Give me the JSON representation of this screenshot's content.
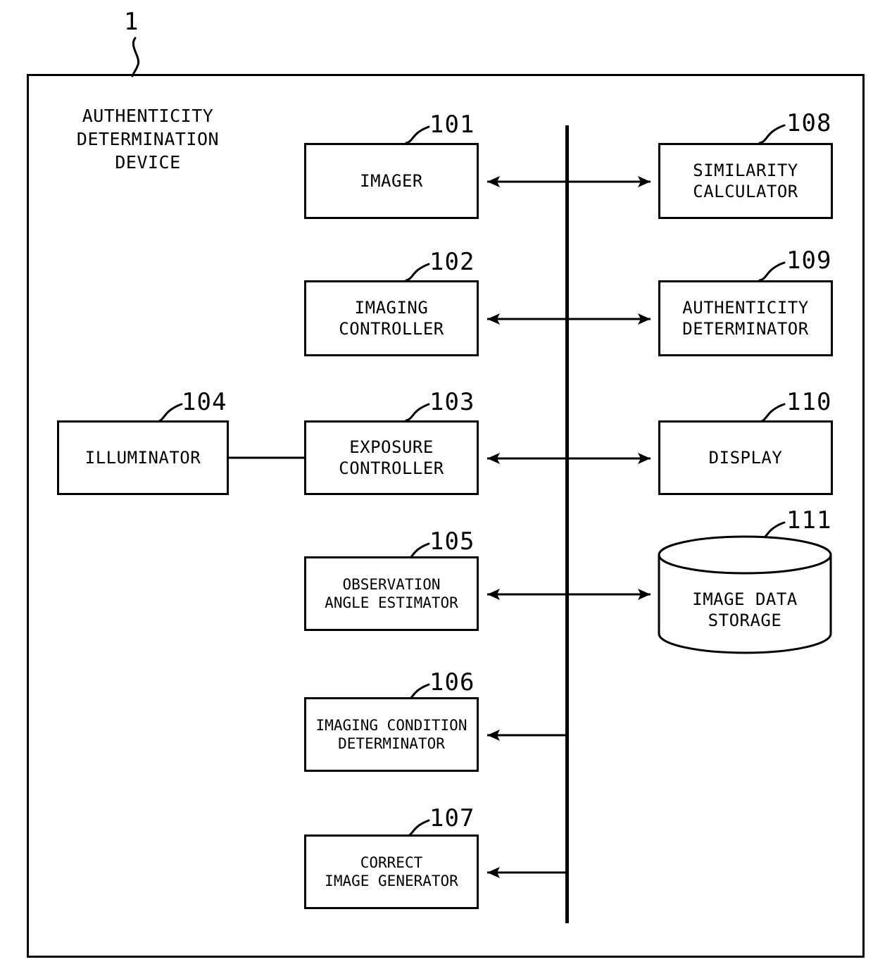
{
  "figure": {
    "reference_numeral": "1",
    "device_title": "AUTHENTICITY\nDETERMINATION\nDEVICE"
  },
  "blocks": [
    {
      "id": "imager",
      "ref": "101",
      "label": "IMAGER",
      "shape": "rect",
      "column": "center",
      "row": 1
    },
    {
      "id": "imaging-controller",
      "ref": "102",
      "label": "IMAGING\nCONTROLLER",
      "shape": "rect",
      "column": "center",
      "row": 2
    },
    {
      "id": "exposure-controller",
      "ref": "103",
      "label": "EXPOSURE\nCONTROLLER",
      "shape": "rect",
      "column": "center",
      "row": 3
    },
    {
      "id": "illuminator",
      "ref": "104",
      "label": "ILLUMINATOR",
      "shape": "rect",
      "column": "left",
      "row": 3
    },
    {
      "id": "observation-angle-estimator",
      "ref": "105",
      "label": "OBSERVATION\nANGLE ESTIMATOR",
      "shape": "rect",
      "column": "center",
      "row": 4
    },
    {
      "id": "imaging-condition-determinator",
      "ref": "106",
      "label": "IMAGING CONDITION\nDETERMINATOR",
      "shape": "rect",
      "column": "center",
      "row": 5
    },
    {
      "id": "correct-image-generator",
      "ref": "107",
      "label": "CORRECT\nIMAGE GENERATOR",
      "shape": "rect",
      "column": "center",
      "row": 6
    },
    {
      "id": "similarity-calculator",
      "ref": "108",
      "label": "SIMILARITY\nCALCULATOR",
      "shape": "rect",
      "column": "right",
      "row": 1
    },
    {
      "id": "authenticity-determinator",
      "ref": "109",
      "label": "AUTHENTICITY\nDETERMINATOR",
      "shape": "rect",
      "column": "right",
      "row": 2
    },
    {
      "id": "display",
      "ref": "110",
      "label": "DISPLAY",
      "shape": "rect",
      "column": "right",
      "row": 3
    },
    {
      "id": "image-data-storage",
      "ref": "111",
      "label": "IMAGE DATA\nSTORAGE",
      "shape": "cylinder",
      "column": "right",
      "row": 4
    }
  ],
  "connections": [
    {
      "from": "similarity-calculator",
      "to": "imager",
      "style": "bidirectional-bus"
    },
    {
      "from": "authenticity-determinator",
      "to": "imaging-controller",
      "style": "bidirectional-bus"
    },
    {
      "from": "display",
      "to": "exposure-controller",
      "style": "bidirectional-bus"
    },
    {
      "from": "image-data-storage",
      "to": "observation-angle-estimator",
      "style": "bidirectional-bus"
    },
    {
      "from": "bus",
      "to": "imaging-condition-determinator",
      "style": "arrow-left"
    },
    {
      "from": "bus",
      "to": "correct-image-generator",
      "style": "arrow-left"
    },
    {
      "from": "illuminator",
      "to": "exposure-controller",
      "style": "plain-line"
    }
  ],
  "colors": {
    "line": "#000000",
    "background": "#ffffff"
  }
}
